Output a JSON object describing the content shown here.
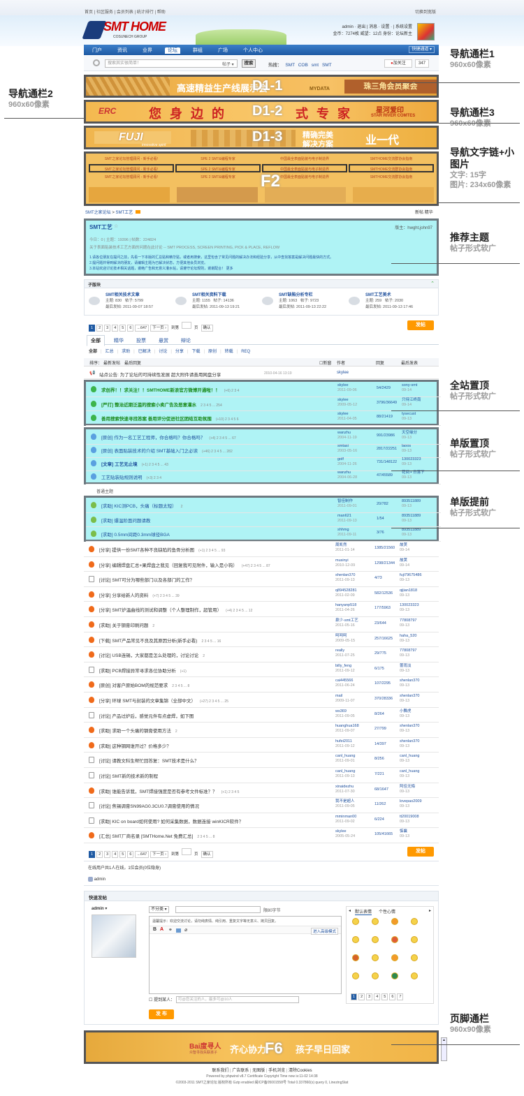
{
  "topnav": {
    "links": [
      "首页",
      "社区服务",
      "会员列表",
      "统计排行",
      "帮助"
    ],
    "right": "切换到宽版"
  },
  "logo": {
    "text": "SMT HOME",
    "sub": "COSUNECH GROUP"
  },
  "user": {
    "line1": "admin · 退出 | 消息 · 设置 · | 系统设置",
    "line2": "金币：7274枚  威望：12点  身份：论坛新主"
  },
  "mainnav": {
    "items": [
      "门户",
      "资讯",
      "业界",
      "论坛",
      "群组",
      "广场",
      "个人中心"
    ],
    "active": "论坛",
    "right": "快捷通道 ▾"
  },
  "search": {
    "placeholder": "搜索其实很简单！",
    "type": "帖子 ▾",
    "button": "搜索",
    "hot_label": "热搜：",
    "hot": [
      "SMT",
      "COB",
      "smt",
      "SMT"
    ],
    "follow": "加关注",
    "follow_count": "347"
  },
  "ads": {
    "d1": {
      "text": "高速精益生产线展示会",
      "tag": "MYDATA",
      "side": "珠三角会员聚会",
      "label": "D1-1"
    },
    "d2": {
      "brand": "ERC",
      "text": "您身边的",
      "text2": "式专家",
      "side": "星河爱印",
      "side2": "STAR RIVER COMTES",
      "label": "D1-2"
    },
    "d3": {
      "brand": "FUJI",
      "sub": "innovative spirit",
      "text": "精确完美",
      "text2": "解决方案",
      "side": "业一代",
      "label": "D1-3"
    },
    "f2": {
      "cells": [
        "SMT之家论坛管理顾问 - 新手必看!",
        "SPE 2 SMT&编程专家",
        "中国最全表面贴装与电子制造界",
        "SMTHOME交流群协会指南"
      ],
      "label": "F2"
    }
  },
  "breadcrumb": {
    "items": [
      "SMT之家论坛",
      "SMT工艺"
    ],
    "right": [
      "新帖",
      "精华"
    ]
  },
  "forum": {
    "title": "SMT工艺",
    "mods": "版主：hwght,john97",
    "stats": "今日：0  |  主题：19396  |  帖数：224824",
    "desc": "关于表面贴装技术工艺方面的问题在此讨论 -- SMT PROCESS, SCREEN PRINTING, PICK & PLACE, REFLOW",
    "rule1": "1.请各位朋友在提问之前，先看一下本版的汇总贴和精华贴，或者用搜索，这里包含了常见问题的解决办法和经验分享，从中查找答案是解决问题最快的方式。",
    "rule2": "2.提问题并得到解决的朋友，请编辑主题为已解决状态，方便其他会员浏览。",
    "rule3": "3.本站欢迎讨论技术相关话题，谢绝广告和无意义灌水帖，请遵守论坛规则，谢谢配合！    更多"
  },
  "subforums": {
    "title": "子版块",
    "items": [
      {
        "name": "SMT相关技术文章",
        "s1": "主题: 830",
        "s2": "帖子: 5799",
        "last": "最后发帖: 2011-09-07 18:57"
      },
      {
        "name": "SMT相关资料下载",
        "s1": "主题: 1155",
        "s2": "帖子: 14136",
        "last": "最后发帖: 2011-09-13 19:21"
      },
      {
        "name": "SMT缺陷分析专栏",
        "s1": "主题: 1063",
        "s2": "帖子: 9723",
        "last": "最后发帖: 2011-09-13 22:22"
      },
      {
        "name": "SMT工艺美术",
        "s1": "主题: 259",
        "s2": "帖子: 2030",
        "last": "最后发帖: 2011-09-13 17:46"
      }
    ]
  },
  "pager": {
    "pages": [
      "1",
      "2",
      "3",
      "4",
      "5",
      "6",
      "...647",
      "下一页 ›"
    ],
    "goto": "到第",
    "page": "页",
    "confirm": "确认",
    "post": "发帖"
  },
  "tabs": {
    "items": [
      "全部",
      "精华",
      "投票",
      "悬赏",
      "辩论"
    ],
    "filters": [
      "全部",
      "汇总",
      "求助",
      "已解决",
      "讨论",
      "分享",
      "下载",
      "原创",
      "转载",
      "REQ"
    ]
  },
  "list_header": {
    "sort": "排序：",
    "sort1": "最新发帖",
    "sort2": "最后回复",
    "new": "新窗",
    "author": "作者",
    "replies": "回复",
    "last": "最后发表"
  },
  "announce": {
    "text": "站点公告: 为了论坛的可持续性发展 超大附件请善用网盘分享",
    "date": "2010-04-16 13:19",
    "author": "skylee"
  },
  "global_top": [
    {
      "title": "求创界！！求关注！！SMTHOME新浪官方微博开通啦！！",
      "pages": "(+6) 2 3 4",
      "author": "skylee",
      "date": "2011-09-06",
      "rep": "54/2429",
      "last": "sony-smt",
      "ld": "09-14"
    },
    {
      "title": "[严打] 整治近期泛滥的搜索小卖广告及恶意灌水",
      "pages": "2 3 4 5 ... 254",
      "author": "skylee",
      "date": "2009-05-12",
      "rep": "3796/36649",
      "last": "只待江终南",
      "ld": "09-14"
    },
    {
      "title": "善用搜索快速寻找答案  善用评分促进社区团结互助氛围",
      "pages": "(+10) 2 3 4 5 6",
      "author": "skylee",
      "date": "2011-04-05",
      "rep": "88/21419",
      "last": "tysecust",
      "ld": "09-13"
    }
  ],
  "board_top": [
    {
      "title": "[原创] 作为一名工艺工程师，你合格吗？你合格吗？",
      "pages": "(+4) 2 3 4 5 ... 67",
      "author": "wanzhu",
      "date": "2004-11-19",
      "rep": "991/23986",
      "last": "天空缘分",
      "ld": "09-13"
    },
    {
      "title": "[原创] 表面贴装技术的介绍 SMT基础入门之必读",
      "pages": "(+46) 2 3 4 5 ... 282",
      "author": "smtasi",
      "date": "2003-05-16",
      "rep": "2817/22251",
      "last": "laoos",
      "ld": "09-13"
    },
    {
      "title": "[文章] 工艺无止境",
      "pages": "(+1) 2 3 4 5 ... 43",
      "author": "golf",
      "date": "2004-11-26",
      "rep": "731/148122",
      "last": "130023323",
      "ld": "09-13"
    },
    {
      "title": "工艺贴装贴规则说明",
      "pages": "(+3) 2 3 4",
      "author": "wanzhu",
      "date": "2004-06-28",
      "rep": "47/45589",
      "last": "花间 ▪ 日落下",
      "ld": "09-13"
    }
  ],
  "normal_label": "普通主题",
  "board_front": [
    {
      "title": "[求助] KIC测PCB，头痛（标题太短）",
      "pages": "2",
      "author": "智佳制作",
      "date": "2011-09-01",
      "rep": "20/782",
      "last": "893511889",
      "ld": "09-13"
    },
    {
      "title": "[求助] 爆温阶面问题请教",
      "pages": "",
      "author": "man621",
      "date": "2011-09-13",
      "rep": "1/54",
      "last": "893511889",
      "ld": "09-13"
    },
    {
      "title": "[求助] 0.5mm间距0.3mm球径BGA",
      "pages": "",
      "author": "shhmg",
      "date": "2011-09-11",
      "rep": "3/76",
      "last": "893511889",
      "ld": "09-13"
    }
  ],
  "threads": [
    {
      "t": "[分享] 提供一份SMT各种不良缺陷的鱼骨分析图",
      "p": "(+1) 2 3 4 5 ... 93",
      "a": "周凯然",
      "d": "2011-01-14",
      "r": "1385/21560",
      "l": "故荚",
      "ld": "09-14",
      "hot": true
    },
    {
      "t": "[分享] 编辑焊盘汇总+果焊盘之我见（回复我可见附件，输入是小钩）",
      "p": "(+47) 2 3 4 5 ... 87",
      "a": "musinyi",
      "d": "2010-12-09",
      "r": "1298/21344",
      "l": "故荚",
      "ld": "09-14",
      "hot": true
    },
    {
      "t": "[讨论] SMT可分为哪些部门以及各部门的工作？",
      "p": "",
      "a": "shenlan370",
      "d": "2011-09-13",
      "r": "4/73",
      "l": "fuji79675486",
      "ld": "09-13",
      "hot": false
    },
    {
      "t": "[分享] 分享给新人的资料",
      "p": "(+7) 2 3 4 5 ... 39",
      "a": "q894528281",
      "d": "2011-02-09",
      "r": "582/12536",
      "l": "qijian1818",
      "ld": "09-13",
      "hot": true
    },
    {
      "t": "[分享] SMT炉温曲线的测试和调整（个人整理制作，超管用）",
      "p": "(+4) 2 3 4 5 ... 12",
      "a": "hanyanp518",
      "d": "2011-04-26",
      "r": "177/5963",
      "l": "130023323",
      "ld": "09-13",
      "hot": true
    },
    {
      "t": "[求助] 关于钢膏印刷问题",
      "p": "2",
      "a": "泉少-smt工艺",
      "d": "2011-05-16",
      "r": "23/644",
      "l": "77808797",
      "ld": "09-13",
      "hot": true
    },
    {
      "t": "[下载] SMT产品常见不良及其原因分析(新手必看)",
      "p": "2 3 4 5 ... 16",
      "a": "呵呵呵",
      "d": "2009-05-15",
      "r": "257/16625",
      "l": "haha_520",
      "ld": "09-13",
      "hot": true
    },
    {
      "t": "[讨论] USB连锡，大家都是怎么处理的，讨论讨论",
      "p": "2",
      "a": "really",
      "d": "2011-07-25",
      "r": "29/775",
      "l": "77808797",
      "ld": "09-13",
      "hot": true
    },
    {
      "t": "[求助] PCB焊接异常寻求各位协助分析",
      "p": "(+1)",
      "a": "billy_feng",
      "d": "2011-09-12",
      "r": "6/175",
      "l": "蕾雨淡",
      "ld": "09-13",
      "hot": false
    },
    {
      "t": "[原创] 对客户原始BOM的规范要求",
      "p": "2 3 4 5 ... 8",
      "a": "cai445566",
      "d": "2011-06-24",
      "r": "107/2295",
      "l": "shenlan370",
      "ld": "09-13",
      "hot": true
    },
    {
      "t": "[分享] 环球 SMT与封装的文章集锦（全部中文）",
      "p": "(+27) 2 3 4 5 ... 25",
      "a": "mail",
      "d": "2009-11-07",
      "r": "370/28336",
      "l": "shenlan370",
      "ld": "09-13",
      "hot": true
    },
    {
      "t": "[讨论] 产品过炉后，感觉元件有点虚焊，如下图",
      "p": "",
      "a": "ws369",
      "d": "2011-09-05",
      "r": "8/264",
      "l": "小舞虎",
      "ld": "09-13",
      "hot": false
    },
    {
      "t": "[求助] 求助一个头痛的钢膏使用方法",
      "p": "2",
      "a": "huanghua168",
      "d": "2011-09-07",
      "r": "27/799",
      "l": "shenlan370",
      "ld": "09-13",
      "hot": true
    },
    {
      "t": "[求助] 这种钢网谁开过？价格多少？",
      "p": "",
      "a": "hufei2011",
      "d": "2011-09-12",
      "r": "14/397",
      "l": "shenlan370",
      "ld": "09-13",
      "hot": true
    },
    {
      "t": "[讨论] 请教文科生帮忙回答复：SMT技术是什么？",
      "p": "",
      "a": "canl_huang",
      "d": "2011-09-01",
      "r": "8/256",
      "l": "canl_huang",
      "ld": "09-13",
      "hot": false
    },
    {
      "t": "[讨论] SMT新的技术新的制程",
      "p": "",
      "a": "canl_huang",
      "d": "2011-09-13",
      "r": "7/221",
      "l": "canl_huang",
      "ld": "09-13",
      "hot": false
    },
    {
      "t": "[求助] 谁能告诉我，SMT焊接强度是否有参考文件标准？？",
      "p": "(+1) 2 3 4 5",
      "a": "xinaidezhu",
      "d": "2011-07-30",
      "r": "68/1647",
      "l": "阿佳无悔",
      "ld": "09-13",
      "hot": true
    },
    {
      "t": "[讨论] 焦锡调膏SN99AG0.3CU0.7调膏使用的情况",
      "p": "",
      "a": "我不是超人",
      "d": "2011-09-05",
      "r": "11/262",
      "l": "lovepao2009",
      "ld": "09-13",
      "hot": false
    },
    {
      "t": "[求助] KIC on board如何使用? 如何采集数据，数据连接 winKICR软件？",
      "p": "",
      "a": "mminman00",
      "d": "2011-09-02",
      "r": "6/224",
      "l": "tt20019008",
      "ld": "09-13",
      "hot": false
    },
    {
      "t": "[汇总] SMT厂商名录 [SMTHome.Net 免费汇总]",
      "p": "2 3 4 5 ... 8",
      "a": "skylee",
      "d": "2005-05-24",
      "r": "105/41665",
      "l": "惦襄",
      "ld": "09-13",
      "hot": true
    }
  ],
  "online": {
    "text": "在线用户共1人在线，1位会员(0位隐身)",
    "user": "admin"
  },
  "quickpost": {
    "title": "快速发帖",
    "user": "admin ▾",
    "category": "不分类 ▾",
    "limit": "限80字节",
    "tip": "温馨提示：欢迎交流讨论，请勿纯表情、纯引用、重复文字等无意义、拷贝回复。",
    "advanced": "进入高级模式",
    "emo_tabs": [
      "默认表情",
      "个性心情"
    ],
    "emo_pages": [
      "1",
      "2",
      "3",
      "4",
      "5",
      "6",
      "7"
    ],
    "mention_label": "提到某人：",
    "mention_ph": "可@您关注的人，最多可@10人",
    "submit": "发 布"
  },
  "footer_ad": {
    "brand": "Bai度寻人",
    "sub": "众智寻找失联孩子",
    "text": "齐心协力",
    "text2": "孩子早日回家",
    "label": "F6"
  },
  "footer": {
    "links": [
      "联系我们",
      "广告联系",
      "无图版",
      "手机浏览",
      "清除Cookies"
    ],
    "l1": "Powered by phpwind v8.7 Certificate Copyright Time now is:11-02 14:38",
    "l2": "©2003-2011 SMT之家论坛 版权所有 Gzip enabled 闽ICP备05001558号 Total 0.337860(s) query 0, LinezingStat"
  },
  "annotations": [
    {
      "t": "导航通栏1",
      "s": "960x60像素"
    },
    {
      "t": "导航通栏2",
      "s": "960x60像素"
    },
    {
      "t": "导航通栏3",
      "s": "960x60像素"
    },
    {
      "t": "导航文字链+小图片",
      "s": "文字: 15字",
      "s2": "图片: 234x60像素"
    },
    {
      "t": "推荐主题",
      "s": "帖子形式软广"
    },
    {
      "t": "全站置顶",
      "s": "帖子形式软广"
    },
    {
      "t": "单版置顶",
      "s": "帖子形式软广"
    },
    {
      "t": "单版提前",
      "s": "帖子形式软广"
    },
    {
      "t": "页脚通栏",
      "s": "960x90像素"
    }
  ]
}
